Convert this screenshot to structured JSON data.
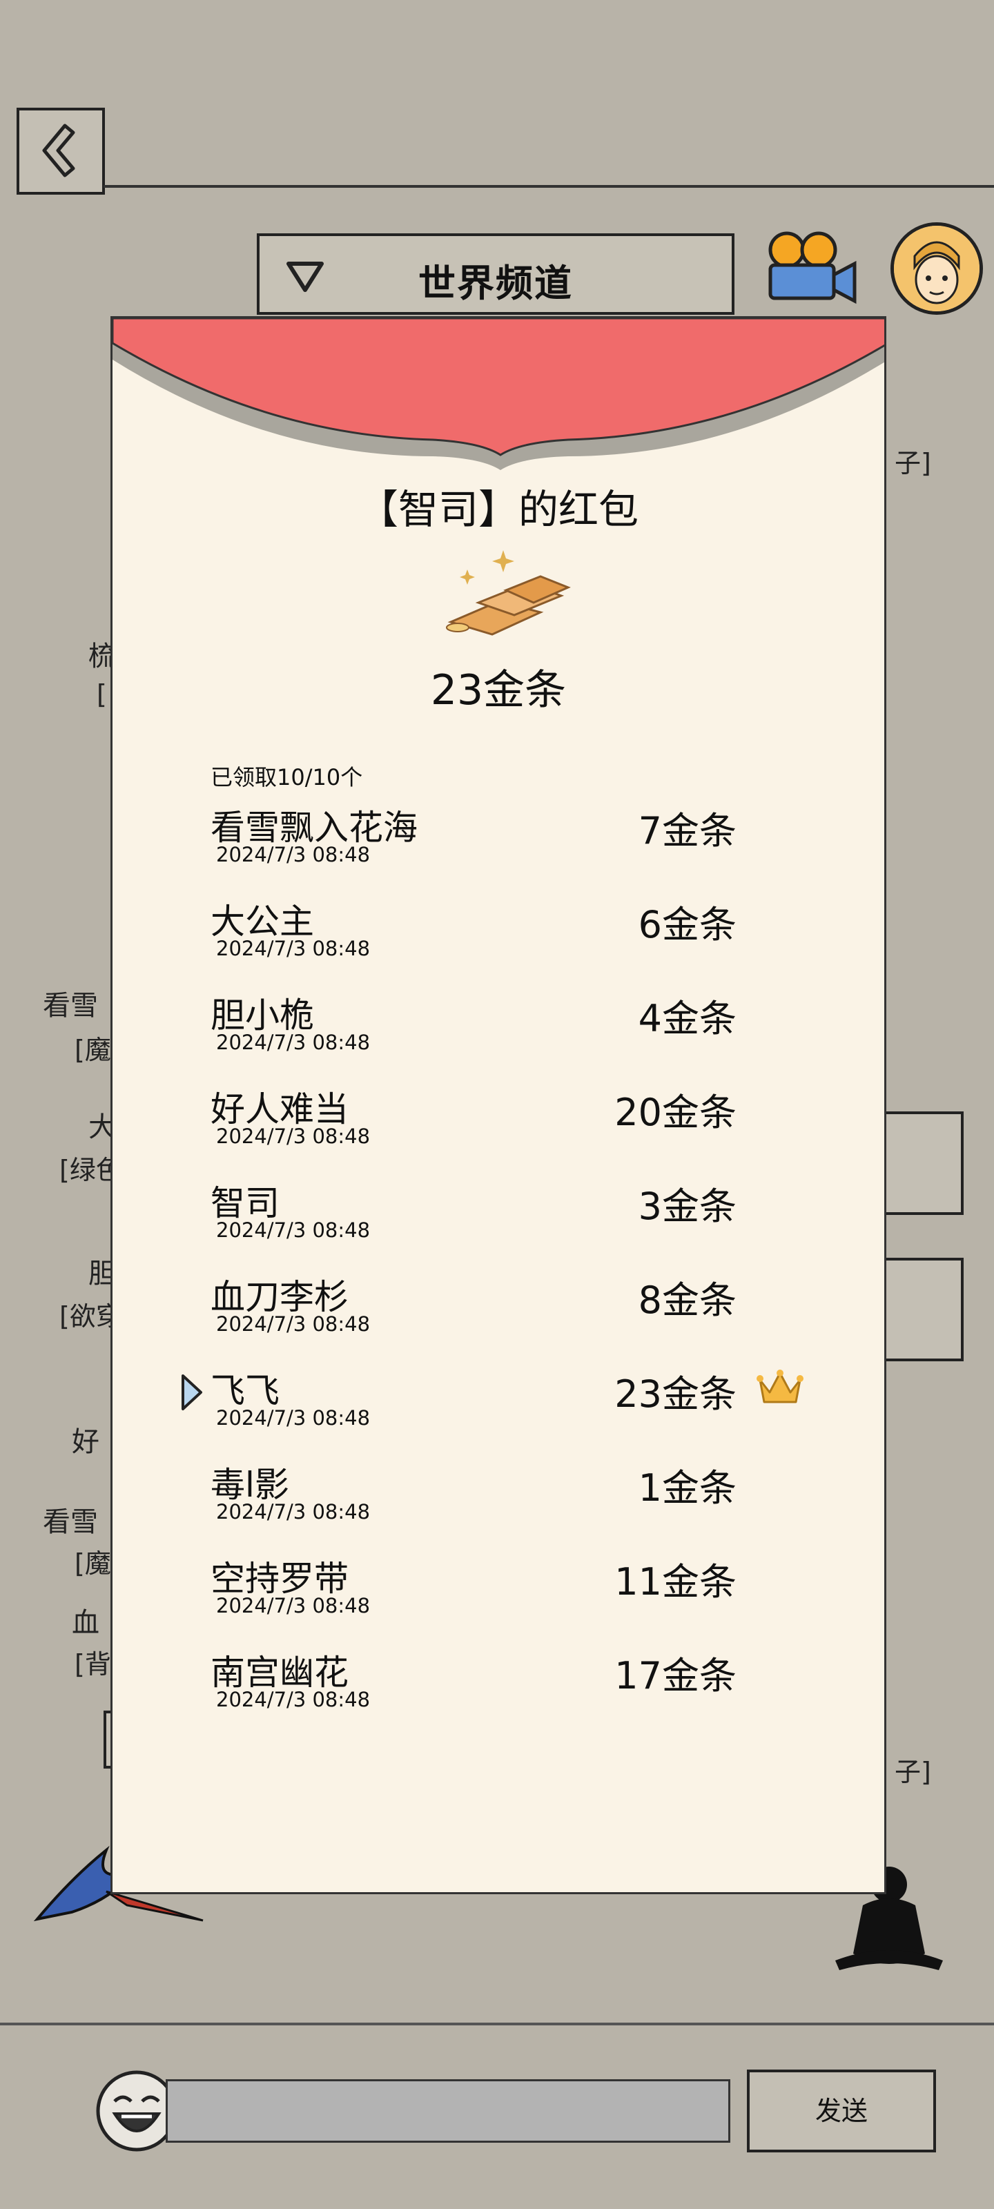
{
  "header": {
    "channel_title": "世界频道"
  },
  "background": {
    "peeks": [
      "子]",
      "梳",
      "[",
      "看雪",
      "[魔",
      "大",
      "[绿色",
      "胆",
      "[欲穿",
      "好",
      "看雪",
      "[魔",
      "血",
      "[背",
      "子]"
    ]
  },
  "red_packet": {
    "title": "【智司】的红包",
    "total_amount": "23金条",
    "claimed_text": "已领取10/10个",
    "entries": [
      {
        "name": "看雪飘入花海",
        "time": "2024/7/3 08:48",
        "amount": "7金条"
      },
      {
        "name": "大公主",
        "time": "2024/7/3 08:48",
        "amount": "6金条"
      },
      {
        "name": "胆小桅",
        "time": "2024/7/3 08:48",
        "amount": "4金条"
      },
      {
        "name": "好人难当",
        "time": "2024/7/3 08:48",
        "amount": "20金条"
      },
      {
        "name": "智司",
        "time": "2024/7/3 08:48",
        "amount": "3金条"
      },
      {
        "name": "血刀李杉",
        "time": "2024/7/3 08:48",
        "amount": "8金条"
      },
      {
        "name": "飞飞",
        "time": "2024/7/3 08:48",
        "amount": "23金条"
      },
      {
        "name": "毒l影",
        "time": "2024/7/3 08:48",
        "amount": "1金条"
      },
      {
        "name": "空持罗带",
        "time": "2024/7/3 08:48",
        "amount": "11金条"
      },
      {
        "name": "南宫幽花",
        "time": "2024/7/3 08:48",
        "amount": "17金条"
      }
    ]
  },
  "footer": {
    "send_label": "发送"
  },
  "colors": {
    "flap": "#f06b6b",
    "modal_bg": "#faf3e6",
    "page_bg": "#b8b3a8"
  }
}
